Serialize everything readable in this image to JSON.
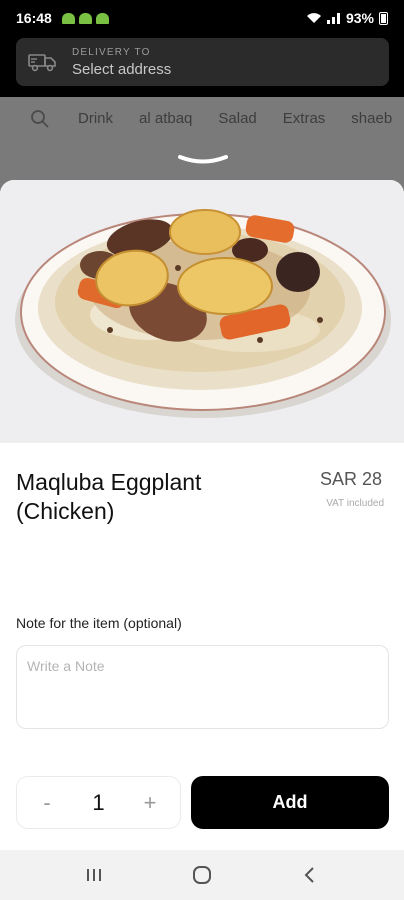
{
  "status_bar": {
    "time": "16:48",
    "battery": "93%",
    "icons": [
      "android-icon",
      "android-icon",
      "android-icon",
      "wifi-icon",
      "signal-icon",
      "battery-icon"
    ]
  },
  "delivery": {
    "label": "DELIVERY TO",
    "value": "Select address",
    "icon": "truck-icon"
  },
  "tabs": {
    "items": [
      "Drink",
      "al atbaq",
      "Salad",
      "Extras",
      "shaeb"
    ]
  },
  "item": {
    "title": "Maqluba Eggplant (Chicken)",
    "price": "SAR 28",
    "vat_note": "VAT included"
  },
  "note": {
    "label": "Note for the item (optional)",
    "placeholder": "Write a Note",
    "value": ""
  },
  "order": {
    "decrement": "-",
    "quantity": "1",
    "increment": "+",
    "add_label": "Add"
  },
  "colors": {
    "accent": "#000000",
    "overlay": "#7a7a7a"
  }
}
